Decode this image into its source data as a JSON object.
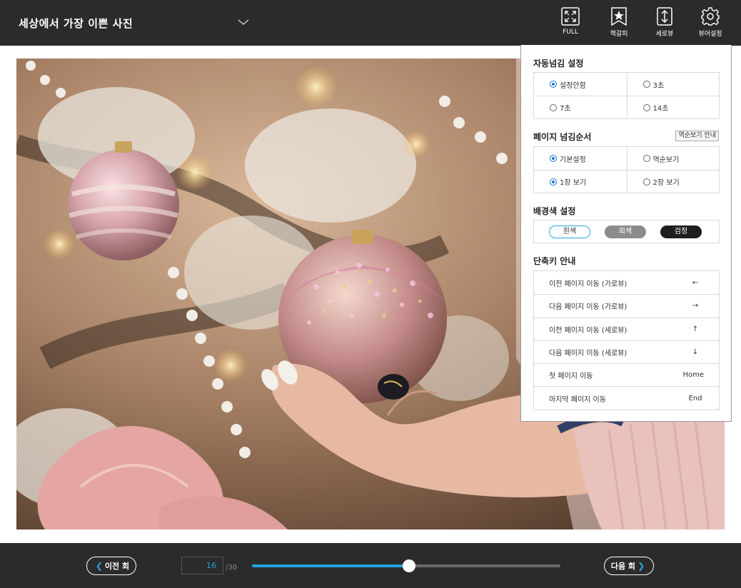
{
  "header": {
    "title": "세상에서 가장 이쁜 사진",
    "tools": [
      {
        "label": "FULL",
        "icon": "fullscreen-icon"
      },
      {
        "label": "책갈피",
        "icon": "bookmark-star-icon"
      },
      {
        "label": "세로뷰",
        "icon": "vertical-view-icon"
      },
      {
        "label": "뷰어설정",
        "icon": "gear-icon"
      }
    ]
  },
  "settings": {
    "auto_flip": {
      "title": "자동넘김 설정",
      "options": [
        "설정안함",
        "3초",
        "7초",
        "14초"
      ],
      "selected": "설정안함"
    },
    "page_order": {
      "title": "페이지 넘김순서",
      "help_label": "역순보기 안내",
      "options": [
        "기본설정",
        "역순보기",
        "1장 보기",
        "2장 보기"
      ],
      "selected": [
        "기본설정",
        "1장 보기"
      ]
    },
    "background": {
      "title": "배경색 설정",
      "options": [
        "흰색",
        "회색",
        "검정"
      ]
    },
    "shortcuts": {
      "title": "단축키 안내",
      "rows": [
        {
          "action": "이전 페이지 이동 (가로뷰)",
          "key": "←"
        },
        {
          "action": "다음 페이지 이동 (가로뷰)",
          "key": "→"
        },
        {
          "action": "이전 페이지 이동 (세로뷰)",
          "key": "↑"
        },
        {
          "action": "다음 페이지 이동 (세로뷰)",
          "key": "↓"
        },
        {
          "action": "첫 페이지 이동",
          "key": "Home"
        },
        {
          "action": "마지막 페이지 이동",
          "key": "End"
        }
      ]
    }
  },
  "footer": {
    "prev_label": "이전 회",
    "next_label": "다음 회",
    "current_page": "16",
    "total_pages": "/30",
    "progress": 0.5
  },
  "colors": {
    "bar_bg": "#2b2b2b",
    "accent_blue": "#2aa7db",
    "slider_fill": "#1fa3e0",
    "radio_on": "#1a73d9"
  }
}
